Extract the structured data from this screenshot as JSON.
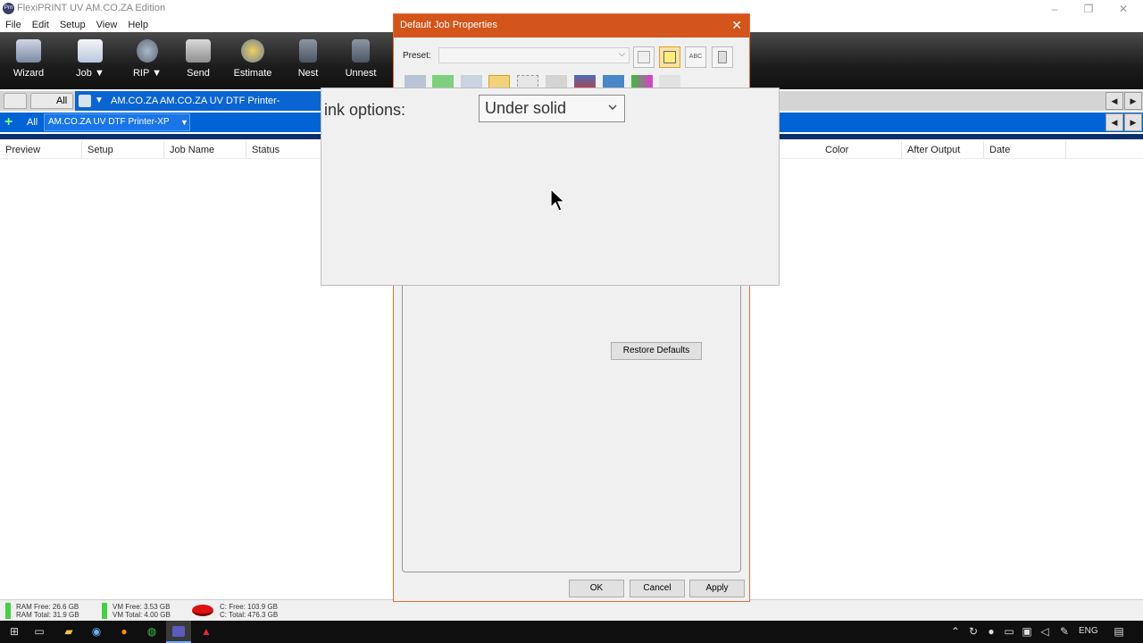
{
  "window": {
    "title": "FlexiPRINT UV AM.CO.ZA Edition",
    "app_icon_text": "Prn",
    "controls": {
      "minimize": "–",
      "restore": "❐",
      "close": "✕"
    }
  },
  "menu": [
    "File",
    "Edit",
    "Setup",
    "View",
    "Help"
  ],
  "toolbar": [
    {
      "label": "Wizard",
      "icon": "wizard-icon"
    },
    {
      "label": "Job",
      "dropdown": "▼",
      "icon": "job-folder-icon"
    },
    {
      "label": "RIP",
      "dropdown": "▼",
      "icon": "rip-globe-icon"
    },
    {
      "label": "Send",
      "icon": "send-printer-icon"
    },
    {
      "label": "Estimate",
      "icon": "estimate-gauge-icon"
    },
    {
      "label": "Nest",
      "icon": "nest-icon"
    },
    {
      "label": "Unnest",
      "icon": "unnest-icon"
    }
  ],
  "printer_row1": {
    "all_label": "All",
    "path": "AM.CO.ZA AM.CO.ZA UV DTF Printer-XP@FILE:",
    "arrow": "▼"
  },
  "printer_row2": {
    "add": "+",
    "all_label": "All",
    "printer_name": "AM.CO.ZA UV DTF Printer-XP",
    "arrow": "▼"
  },
  "nav": {
    "left": "◀",
    "right": "▶"
  },
  "columns": [
    "Preview",
    "Setup",
    "Job Name",
    "Status",
    "Color",
    "After Output",
    "Date"
  ],
  "status": {
    "ram_free": "RAM Free: 26.6 GB",
    "ram_total": "RAM Total: 31.9 GB",
    "vm_free": "VM Free: 3.53 GB",
    "vm_total": "VM Total: 4.00 GB",
    "disk_free": "C: Free: 103.9 GB",
    "disk_total": "C: Total: 476.3 GB"
  },
  "taskbar": {
    "lang": "ENG"
  },
  "dialog": {
    "title": "Default Job Properties",
    "close": "✕",
    "preset_label": "Preset:",
    "preset_value": "",
    "preset_chevron": "⌵",
    "abc_label": "ABC",
    "restore_defaults": "Restore Defaults",
    "ok": "OK",
    "cancel": "Cancel",
    "apply": "Apply"
  },
  "zoom": {
    "ink_label": "ink options:",
    "ink_value": "Under solid"
  },
  "colors": {
    "dialog_title": "#d4551b",
    "printer_bar": "#0063d6",
    "toolbar": "#1c1c1c"
  }
}
